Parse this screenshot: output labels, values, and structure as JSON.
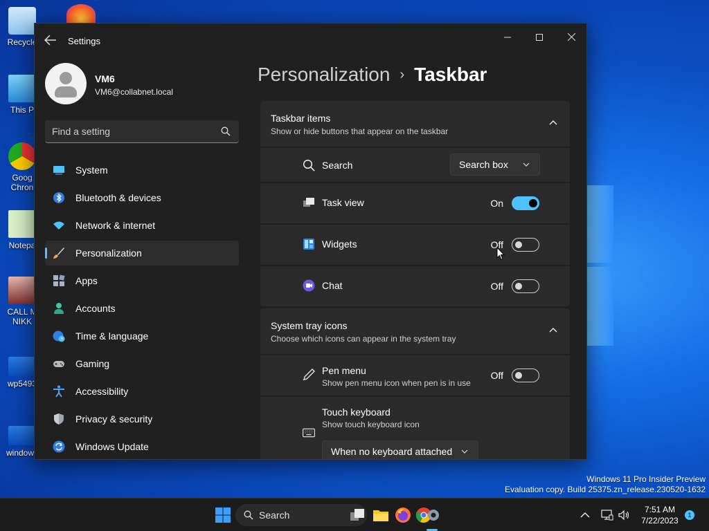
{
  "desktop": {
    "icons": [
      "Recycle",
      "This P",
      "Goog Chron",
      "Notepa",
      "CALL M NIKK",
      "wp5493",
      "windows"
    ],
    "watermark": {
      "line1": "Windows 11 Pro Insider Preview",
      "line2": "Evaluation copy. Build 25375.zn_release.230520-1632"
    }
  },
  "window": {
    "title": "Settings",
    "caption_icons": [
      "minimize-icon",
      "maximize-icon",
      "close-icon"
    ]
  },
  "profile": {
    "name": "VM6",
    "email": "VM6@collabnet.local"
  },
  "search": {
    "placeholder": "Find a setting"
  },
  "sidebar": {
    "items": [
      {
        "label": "System",
        "icon": "system-icon",
        "color": "#4cc2ff"
      },
      {
        "label": "Bluetooth & devices",
        "icon": "bluetooth-icon",
        "color": "#4aa3f0"
      },
      {
        "label": "Network & internet",
        "icon": "wifi-icon",
        "color": "#4cc2ff"
      },
      {
        "label": "Personalization",
        "icon": "brush-icon",
        "color": "#f0a24c"
      },
      {
        "label": "Apps",
        "icon": "apps-icon",
        "color": "#a6b4c8"
      },
      {
        "label": "Accounts",
        "icon": "accounts-icon",
        "color": "#3fc5a5"
      },
      {
        "label": "Time & language",
        "icon": "globe-clock-icon",
        "color": "#4cc2ff"
      },
      {
        "label": "Gaming",
        "icon": "gamepad-icon",
        "color": "#b8b8b8"
      },
      {
        "label": "Accessibility",
        "icon": "accessibility-icon",
        "color": "#4aa3f0"
      },
      {
        "label": "Privacy & security",
        "icon": "shield-icon",
        "color": "#9ea5ad"
      },
      {
        "label": "Windows Update",
        "icon": "update-icon",
        "color": "#4cc2ff"
      }
    ],
    "active_index": 3
  },
  "breadcrumb": {
    "parent": "Personalization",
    "separator": "›",
    "current": "Taskbar"
  },
  "taskbar_items": {
    "title": "Taskbar items",
    "subtitle": "Show or hide buttons that appear on the taskbar",
    "search": {
      "label": "Search",
      "dropdown_value": "Search box"
    },
    "task_view": {
      "label": "Task view",
      "state": "On"
    },
    "widgets": {
      "label": "Widgets",
      "state": "Off"
    },
    "chat": {
      "label": "Chat",
      "state": "Off"
    }
  },
  "system_tray": {
    "title": "System tray icons",
    "subtitle": "Choose which icons can appear in the system tray",
    "pen_menu": {
      "label": "Pen menu",
      "sub": "Show pen menu icon when pen is in use",
      "state": "Off"
    },
    "touch_keyboard": {
      "label": "Touch keyboard",
      "sub": "Show touch keyboard icon",
      "dropdown_value": "When no keyboard attached"
    }
  },
  "os_taskbar": {
    "search_label": "Search",
    "time": "7:51 AM",
    "date": "7/22/2023",
    "notifications": "1"
  },
  "colors": {
    "accent": "#4cc2ff",
    "window_bg": "#202020",
    "card_bg": "#2b2b2b"
  }
}
